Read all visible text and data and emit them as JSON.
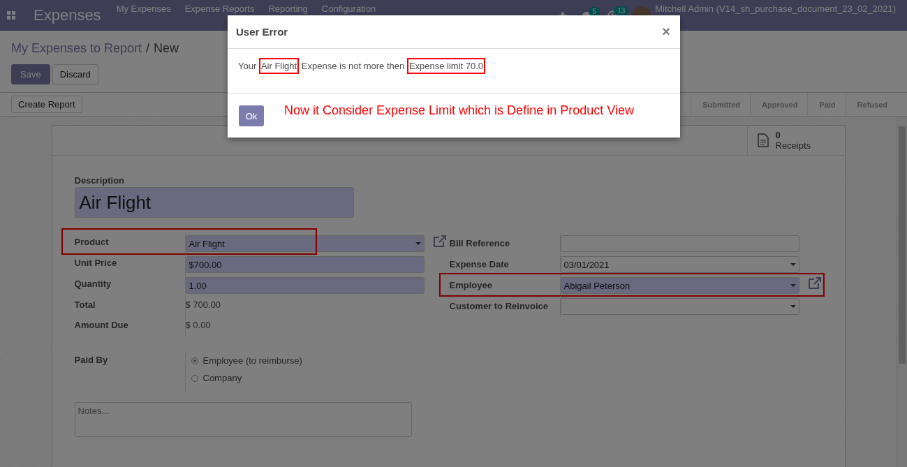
{
  "navbar": {
    "app_title": "Expenses",
    "menu": [
      "My Expenses",
      "Expense Reports",
      "Reporting",
      "Configuration"
    ],
    "chat_count": "5",
    "activity_count": "13",
    "user": "Mitchell Admin (V14_sh_purchase_document_23_02_2021)"
  },
  "breadcrumb": {
    "parent": "My Expenses to Report",
    "separator": "/",
    "current": "New"
  },
  "buttons": [
    {
      "label": "Save",
      "kind": "primary"
    },
    {
      "label": "Discard",
      "kind": "secondary"
    }
  ],
  "create_report": "Create Report",
  "status_steps": [
    "Submitted",
    "Approved",
    "Paid",
    "Refused"
  ],
  "receipts": {
    "count": "0",
    "label": "Receipts"
  },
  "description": {
    "label": "Description",
    "value": "Air Flight"
  },
  "left_fields": [
    {
      "label": "Product",
      "kind": "select",
      "value": "Air Flight",
      "highlighted": true,
      "link": true
    },
    {
      "label": "Unit Price",
      "kind": "input",
      "value": "$700.00",
      "highlighted": false,
      "link": false
    },
    {
      "label": "Quantity",
      "kind": "input",
      "value": "1.00",
      "highlighted": false,
      "link": false
    },
    {
      "label": "Total",
      "kind": "text",
      "value": "$ 700.00",
      "highlighted": false,
      "link": false
    },
    {
      "label": "Amount Due",
      "kind": "text",
      "value": "$ 0.00",
      "highlighted": false,
      "link": false
    }
  ],
  "right_fields": [
    {
      "label": "Bill Reference",
      "kind": "input",
      "required": false,
      "highlighted": false,
      "link": false
    },
    {
      "label": "Expense Date",
      "kind": "select",
      "value": "03/01/2021",
      "required": false,
      "highlighted": false,
      "link": false
    },
    {
      "label": "Employee",
      "kind": "select",
      "value": "Abigail Peterson",
      "required": true,
      "highlighted": true,
      "link": true
    },
    {
      "label": "Customer to Reinvoice",
      "kind": "select",
      "required": false,
      "highlighted": false,
      "link": false
    }
  ],
  "paid_by": {
    "label": "Paid By",
    "options": [
      {
        "label": "Employee (to reimburse)",
        "selected": true
      },
      {
        "label": "Company",
        "selected": false
      }
    ]
  },
  "notes": {
    "placeholder": "Notes..."
  },
  "dialog": {
    "title": "User Error",
    "message": [
      {
        "text": "Your",
        "highlighted": false
      },
      {
        "text": "Air Flight",
        "highlighted": true
      },
      {
        "text": "Expense is not more then",
        "highlighted": false
      },
      {
        "text": "Expense limit 70.0",
        "highlighted": true
      }
    ],
    "close": "×",
    "button": "Ok",
    "annotation": "Now it Consider Expense Limit which is Define in Product View"
  }
}
